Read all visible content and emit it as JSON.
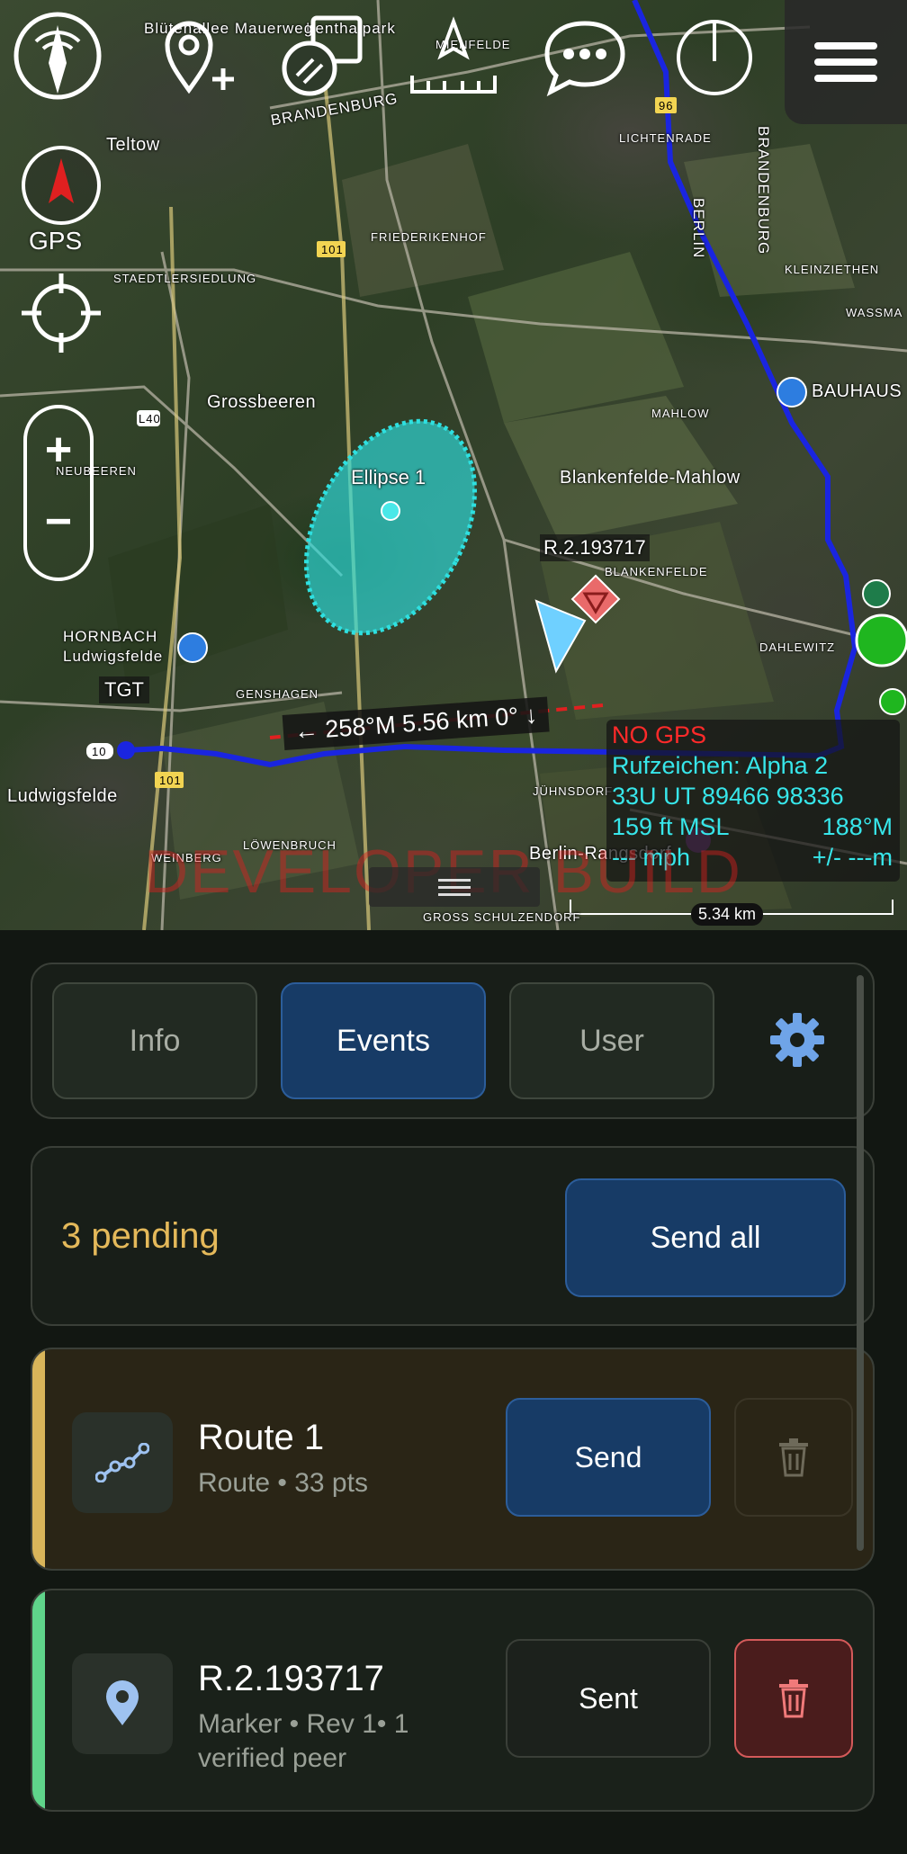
{
  "map": {
    "labels": {
      "teltow": "Teltow",
      "brandenburg": "BRANDENBURG",
      "lichtenrade": "LICHTENRADE",
      "berlin": "BERLIN",
      "brandenburg_v": "BRANDENBURG",
      "friederikenhof": "FRIEDERIKENHOF",
      "kleinziethen": "KLEINZIETHEN",
      "stadtlersiedlung": "STAEDTLERSIEDLUNG",
      "wassma": "WASSMA",
      "grossbeeren": "Grossbeeren",
      "bauhaus": "BAUHAUS",
      "mahlow": "MAHLOW",
      "neubeeren": "NEUBEEREN",
      "blankenfelde_mahlow": "Blankenfelde-Mahlow",
      "blankenfelde": "BLANKENFELDE",
      "hornbach": "HORNBACH",
      "ludwigsfelde_top": "Ludwigsfelde",
      "dahlewitz": "DAHLEWITZ",
      "genshagen": "GENSHAGEN",
      "ludwigsfelde": "Ludwigsfelde",
      "johnsdorf": "JÜHNSDORF",
      "weinberg": "WEINBERG",
      "lowenbruch": "LÖWENBRUCH",
      "berlin_rangsdorf": "Berlin-Rangsdorf",
      "gross_schulzendorf": "GROSS SCHULZENDORF",
      "park": "Lenthalpark",
      "mauer": "Blütenallee Mauerweg",
      "felde": "MIENFELDE",
      "road_101": "101",
      "road_101b": "101",
      "road_96": "96",
      "road_10": "10",
      "road_l40": "L40"
    },
    "ellipse_label": "Ellipse 1",
    "marker_label": "R.2.193717",
    "tgt_label": "TGT",
    "bearing": "← 258°M   5.56 km   0° ↓",
    "gps_label": "GPS",
    "zoom_in": "+",
    "zoom_out": "−",
    "info": {
      "gps_status": "NO GPS",
      "callsign": "Rufzeichen: Alpha 2",
      "grid": "33U  UT  89466  98336",
      "altitude": "159 ft MSL",
      "heading": "188°M",
      "speed": "--- mph",
      "accuracy": "+/- ---m"
    },
    "watermark": "DEVELOPER BUILD",
    "scale": "5.34 km"
  },
  "toolbar": {
    "icons": [
      "compass-icon",
      "add-waypoint-icon",
      "layers-icon",
      "measure-icon",
      "chat-icon",
      "power-icon",
      "hamburger-menu-icon"
    ]
  },
  "panel": {
    "tabs": {
      "info": "Info",
      "events": "Events",
      "user": "User"
    },
    "pending": "3 pending",
    "send_all": "Send all",
    "items": [
      {
        "title": "Route 1",
        "subtitle": "Route • 33 pts",
        "action": "Send",
        "bar_color": "#d9b55a"
      },
      {
        "title": "R.2.193717",
        "subtitle": "Marker • Rev 1• 1 verified peer",
        "action": "Sent",
        "bar_color": "#5fd48a"
      }
    ]
  },
  "colors": {
    "accent_blue": "#173b66",
    "pending_gold": "#e4b95a",
    "route_line": "#1a25e0",
    "ellipse": "#2ee0e0",
    "delete_red": "#d45a5a"
  }
}
